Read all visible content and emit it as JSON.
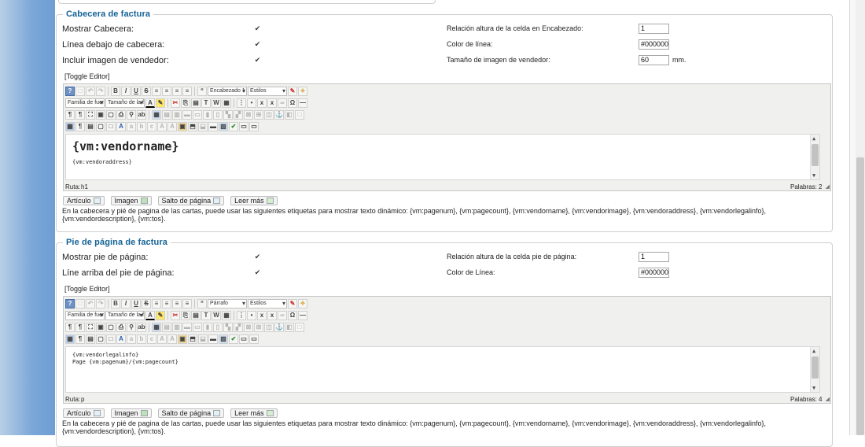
{
  "header_section": {
    "legend": "Cabecera de factura",
    "left_rows": [
      {
        "label": "Mostrar Cabecera:",
        "checked": true
      },
      {
        "label": "Línea debajo de cabecera:",
        "checked": true
      },
      {
        "label": "Incluir imagen de vendedor:",
        "checked": true
      }
    ],
    "right_rows": [
      {
        "label": "Relación altura de la celda en Encabezado:",
        "value": "1",
        "unit": ""
      },
      {
        "label": "Color de línea:",
        "value": "#000000",
        "unit": ""
      },
      {
        "label": "Tamaño de imagen de vendedor:",
        "value": "60",
        "unit": "mm."
      }
    ],
    "toggle_editor": "[Toggle Editor]",
    "editor": {
      "format_select": "Encabezado 1",
      "styles_select": "Estilos",
      "font_family_select": "Familia de fuer",
      "font_size_select": "Tamaño de la f",
      "heading_text": "{vm:vendorname}",
      "body_text": "{vm:vendoraddress}",
      "path_label": "Ruta:",
      "path_value": "h1",
      "words_label": "Palabras: 2"
    },
    "buttons": [
      "Artículo",
      "Imagen",
      "Salto de página",
      "Leer más"
    ],
    "help_text": "En la cabecera y pié de pagina de las cartas, puede usar las siguientes etiquetas para mostrar texto dinámico: {vm:pagenum}, {vm:pagecount}, {vm:vendorname}, {vm:vendorimage}, {vm:vendoraddress}, {vm:vendorlegalinfo}, {vm:vendordescription}, {vm:tos}."
  },
  "footer_section": {
    "legend": "Pie de página de factura",
    "left_rows": [
      {
        "label": "Mostrar pie de página:",
        "checked": true
      },
      {
        "label": "Líne arriba del pie de página:",
        "checked": true
      }
    ],
    "right_rows": [
      {
        "label": "Relación altura de la celda pie de página:",
        "value": "1",
        "unit": ""
      },
      {
        "label": "Color de Línea:",
        "value": "#000000",
        "unit": ""
      }
    ],
    "toggle_editor": "[Toggle Editor]",
    "editor": {
      "format_select": "Párrafo",
      "styles_select": "Estilos",
      "font_family_select": "Familia de fuer",
      "font_size_select": "Tamaño de la f",
      "line1": "{vm:vendorlegalinfo}",
      "line2": "Page {vm:pagenum}/{vm:pagecount}",
      "path_label": "Ruta:",
      "path_value": "p",
      "words_label": "Palabras: 4"
    },
    "buttons": [
      "Artículo",
      "Imagen",
      "Salto de página",
      "Leer más"
    ],
    "help_text": "En la cabecera y pié de pagina de las cartas, puede usar las siguientes etiquetas para mostrar texto dinámico: {vm:pagenum}, {vm:pagecount}, {vm:vendorname}, {vm:vendorimage}, {vm:vendoraddress}, {vm:vendorlegalinfo}, {vm:vendordescription}, {vm:tos}."
  },
  "colors": {
    "legend": "#146295",
    "editor_bar": "#f0f0ee",
    "accent_blue": "#6d91c4"
  },
  "icons": [
    "help-icon",
    "bold-icon",
    "italic-icon",
    "underline-icon",
    "strike-icon",
    "cut-icon",
    "paste-icon",
    "image-icon",
    "link-icon",
    "table-icon"
  ]
}
